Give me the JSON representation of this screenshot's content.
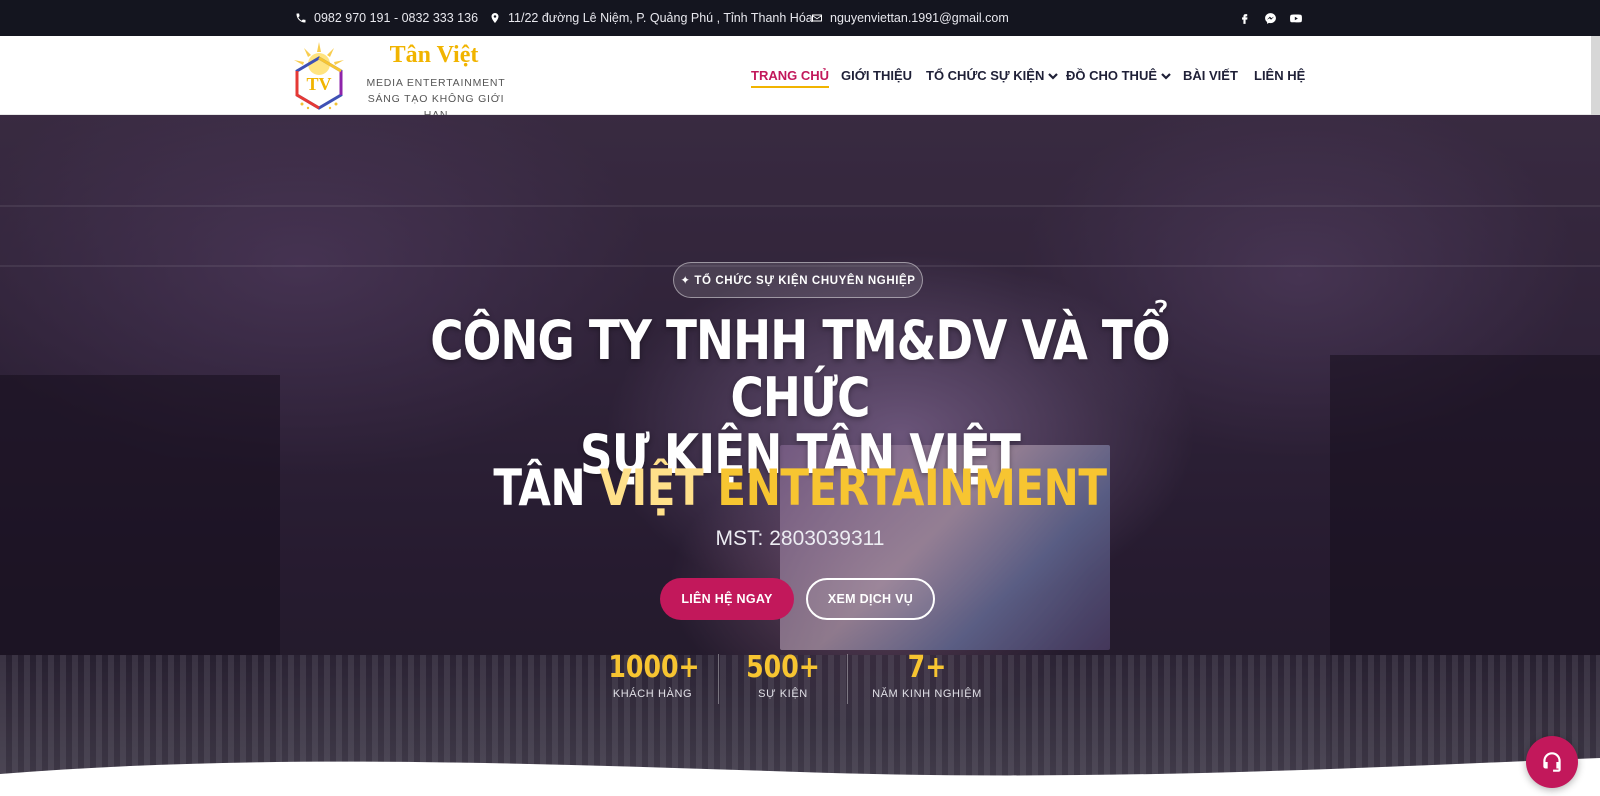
{
  "topbar": {
    "phone": "0982 970 191 - 0832 333 136",
    "address": "11/22 đường Lê Niệm, P. Quảng Phú , Tỉnh Thanh Hóa",
    "email": "nguyenviettan.1991@gmail.com",
    "social_icons": [
      "facebook-icon",
      "messenger-icon",
      "youtube-icon"
    ]
  },
  "header": {
    "brand_name": "Tân Việt",
    "brand_sub1": "MEDIA ENTERTAINMENT",
    "brand_sub2": "SÁNG TẠO KHÔNG GIỚI HẠN",
    "logo_letters": "TV",
    "nav": [
      {
        "label": "TRANG CHỦ",
        "active": true
      },
      {
        "label": "GIỚI THIỆU"
      },
      {
        "label": "TỔ CHỨC SỰ KIỆN",
        "dropdown": true
      },
      {
        "label": "ĐỒ CHO THUÊ",
        "dropdown": true
      },
      {
        "label": "BÀI VIẾT"
      },
      {
        "label": "LIÊN HỆ"
      }
    ]
  },
  "hero": {
    "pill": "✦ TỔ CHỨC SỰ KIỆN CHUYÊN NGHIỆP",
    "title_line1": "CÔNG TY TNHH TM&DV VÀ TỔ CHỨC",
    "title_line2": "SỰ KIỆN TÂN VIỆT",
    "subtitle_part1": "TÂN ",
    "subtitle_part2": "VIỆT ",
    "subtitle_part3": "ENTERTAINMENT",
    "mst": "MST: 2803039311",
    "btn_primary": "LIÊN HỆ NGAY",
    "btn_secondary": "XEM DỊCH VỤ",
    "stats": [
      {
        "value": "1000+",
        "label": "KHÁCH HÀNG"
      },
      {
        "value": "500+",
        "label": "SỰ KIỆN"
      },
      {
        "value": "7+",
        "label": "NĂM KINH NGHIỆM"
      }
    ]
  },
  "colors": {
    "accent": "#c2185b",
    "gold": "#f7c531",
    "topbar_bg": "#14151f"
  }
}
